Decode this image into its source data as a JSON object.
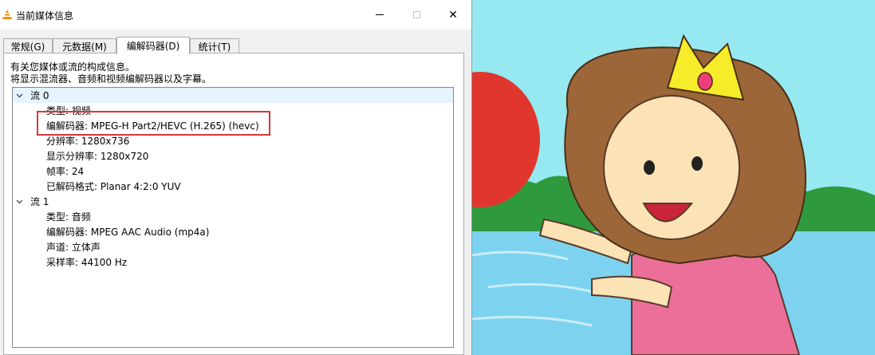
{
  "window": {
    "title": "当前媒体信息",
    "close_glyph": "✕"
  },
  "tabs": [
    {
      "label": "常规(G)",
      "active": false
    },
    {
      "label": "元数据(M)",
      "active": false
    },
    {
      "label": "编解码器(D)",
      "active": true
    },
    {
      "label": "统计(T)",
      "active": false
    }
  ],
  "description": {
    "line1": "有关您媒体或流的构成信息。",
    "line2": "将显示混流器、音频和视频编解码器以及字幕。"
  },
  "streams": [
    {
      "label": "流 0",
      "expanded": true,
      "fields": [
        "类型: 视频",
        "编解码器: MPEG-H Part2/HEVC (H.265) (hevc)",
        "分辨率: 1280x736",
        "显示分辨率: 1280x720",
        "帧率: 24",
        "已解码格式: Planar 4:2:0 YUV"
      ]
    },
    {
      "label": "流 1",
      "expanded": true,
      "fields": [
        "类型: 音频",
        "编解码器: MPEG AAC Audio (mp4a)",
        "声道: 立体声",
        "采样率: 44100 Hz"
      ]
    }
  ],
  "colors": {
    "highlight_box": "#d9363e",
    "selected_row": "#e5f3ff",
    "sky": "#97e9f1",
    "balloon": "#e0362e",
    "crown": "#f7ec2a",
    "hair": "#9c6638",
    "dress": "#ec6f9a"
  },
  "icons": {
    "app": "vlc-cone-icon",
    "expand": "chevron-down-icon"
  }
}
